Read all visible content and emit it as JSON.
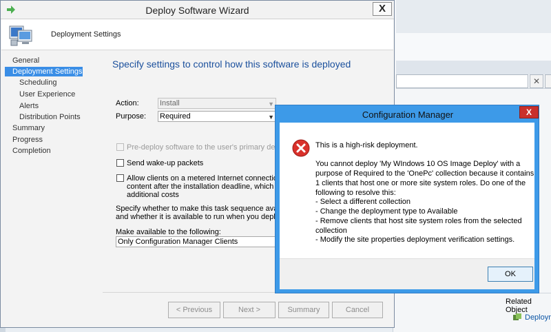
{
  "background_app": {
    "related_objects": "Related Object",
    "related_item": "Deploym"
  },
  "wizard": {
    "title": "Deploy Software Wizard",
    "close_label": "X",
    "header_title": "Deployment Settings",
    "nav": [
      {
        "label": "General",
        "indent": false,
        "active": false
      },
      {
        "label": "Deployment Settings",
        "indent": false,
        "active": true
      },
      {
        "label": "Scheduling",
        "indent": true,
        "active": false
      },
      {
        "label": "User Experience",
        "indent": true,
        "active": false
      },
      {
        "label": "Alerts",
        "indent": true,
        "active": false
      },
      {
        "label": "Distribution Points",
        "indent": true,
        "active": false
      },
      {
        "label": "Summary",
        "indent": false,
        "active": false
      },
      {
        "label": "Progress",
        "indent": false,
        "active": false
      },
      {
        "label": "Completion",
        "indent": false,
        "active": false
      }
    ],
    "content": {
      "heading": "Specify settings to control how this software is deployed",
      "action_label": "Action:",
      "action_value": "Install",
      "purpose_label": "Purpose:",
      "purpose_value": "Required",
      "predeploy_label": "Pre-deploy software to the user's primary device",
      "wakeup_label": "Send wake-up packets",
      "metered_line1": "Allow clients on a metered Internet connection to d",
      "metered_line2": "content after the installation deadline, which might",
      "metered_line3": "additional costs",
      "avail_line1": "Specify whether to make this task sequence available",
      "avail_line2": "and whether it is available to run when you deploy an",
      "make_available_label": "Make available to the following:",
      "make_available_value": "Only Configuration Manager Clients"
    },
    "buttons": {
      "previous": "< Previous",
      "next": "Next >",
      "summary": "Summary",
      "cancel": "Cancel"
    }
  },
  "dialog": {
    "title": "Configuration Manager",
    "close_label": "X",
    "message_lines": [
      "This is a high-risk deployment.",
      "You cannot deploy 'My WIndows 10 OS Image Deploy' with a",
      "purpose of Required to the 'OnePc' collection because it contains",
      "1 clients that host one or more site system roles. Do one of the",
      "following to resolve this:",
      "- Select a different collection",
      "- Change the deployment type to Available",
      "- Remove clients that host site system roles from the selected",
      "collection",
      "- Modify the site properties deployment verification settings."
    ],
    "ok_label": "OK"
  }
}
